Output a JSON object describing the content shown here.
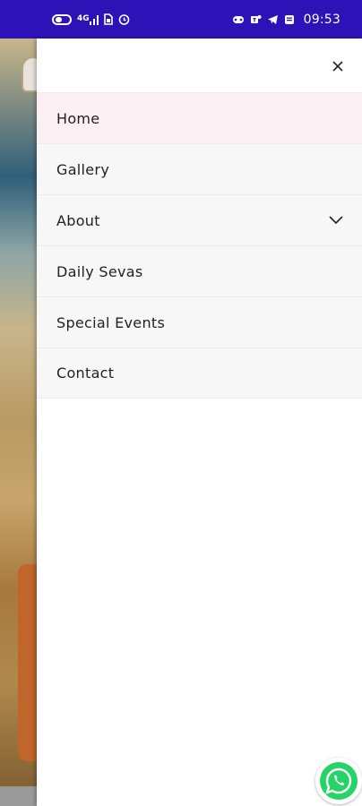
{
  "status_bar": {
    "time": "09:53",
    "network_label": "4G",
    "bg_color": "#2d12b8",
    "left_icons": [
      "battery-saver-icon",
      "signal-icon",
      "sim-icon",
      "alarm-icon"
    ],
    "right_icons": [
      "game-icon",
      "teams-icon",
      "telegram-icon",
      "news-icon"
    ]
  },
  "drawer": {
    "close_icon": "close-icon",
    "items": [
      {
        "label": "Home",
        "active": true
      },
      {
        "label": "Gallery"
      },
      {
        "label": "About",
        "has_submenu": true,
        "icon": "chevron-down-icon"
      },
      {
        "label": "Daily Sevas"
      },
      {
        "label": "Special Events"
      },
      {
        "label": "Contact"
      }
    ]
  },
  "floating": {
    "whatsapp_icon": "whatsapp-icon",
    "whatsapp_color": "#25d366"
  }
}
